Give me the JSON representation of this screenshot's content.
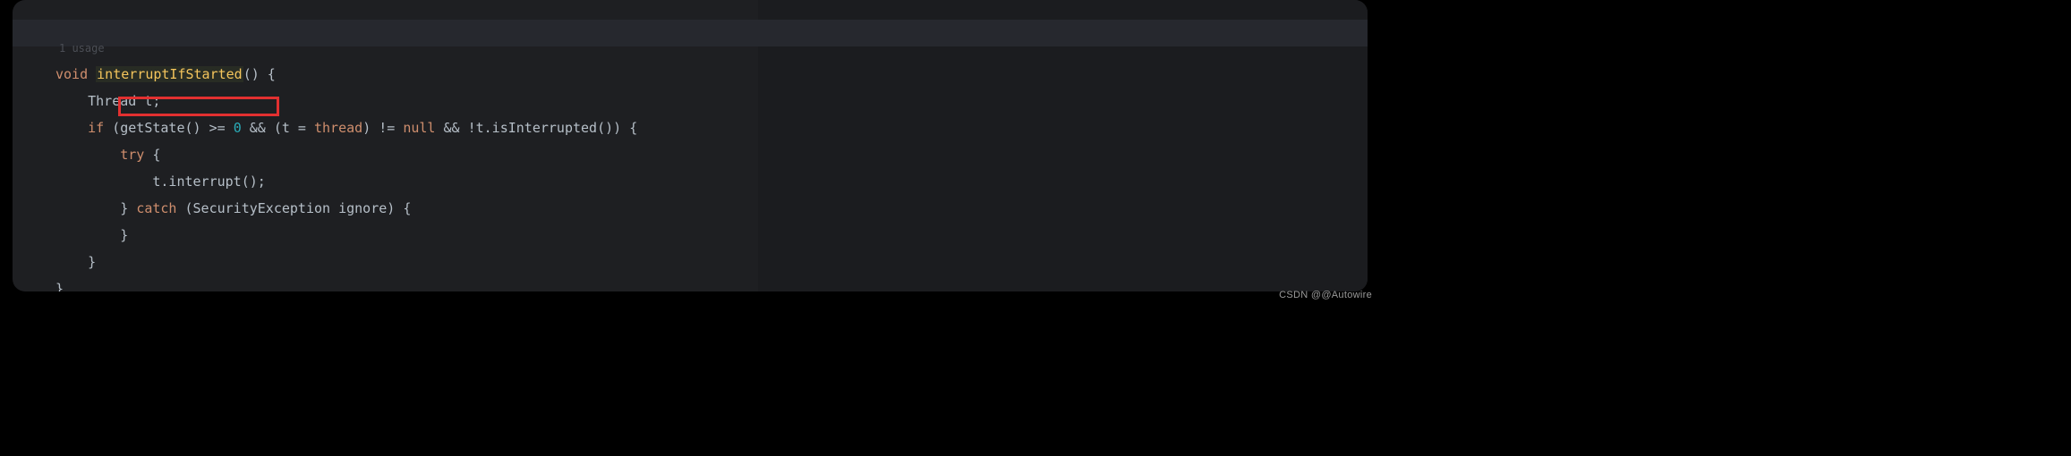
{
  "hint": {
    "usage": "1 usage"
  },
  "code": {
    "kw_void": "void",
    "method_name": "interruptIfStarted",
    "sig_tail": "() {",
    "l2_a": "Thread t;",
    "l3_if": "if",
    "l3_a": " (getState() >= ",
    "l3_zero": "0",
    "l3_b": " && (t = ",
    "l3_thread": "thread",
    "l3_c": ") != ",
    "l3_null": "null",
    "l3_d": " && !t.isInterrupted()) {",
    "l4_try": "try",
    "l4_brace": " {",
    "l5": "t.interrupt();",
    "l6_a": "} ",
    "l6_catch": "catch",
    "l6_b": " (SecurityException ignore) {",
    "l7": "}",
    "l8": "}",
    "l9": "}"
  },
  "watermark": "CSDN @@Autowire"
}
